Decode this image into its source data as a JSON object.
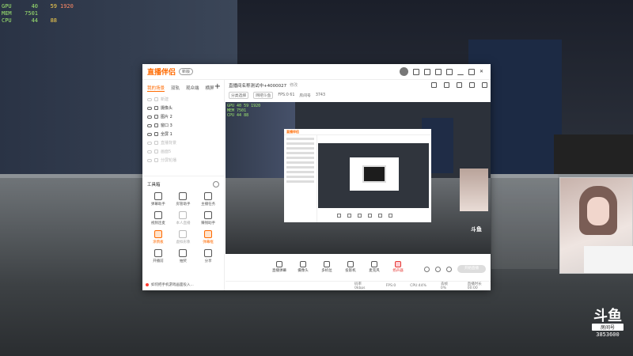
{
  "hardware": [
    {
      "label": "GPU",
      "v1": "40",
      "v2": "59",
      "v3": "1920"
    },
    {
      "label": "MEM",
      "v1": "7501",
      "v2": "",
      "v3": ""
    },
    {
      "label": "CPU",
      "v1": "44",
      "v2": "88",
      "v3": ""
    }
  ],
  "app": {
    "logo": "直播伴侣",
    "version_badge": "新版",
    "sidebar_tabs": [
      "我的场景",
      "双轨",
      "观众端",
      "横屏"
    ],
    "scenes": [
      {
        "name": "新建",
        "dim": true
      },
      {
        "name": "摄像头",
        "dim": false
      },
      {
        "name": "图片 2",
        "dim": false
      },
      {
        "name": "窗口 3",
        "dim": false
      },
      {
        "name": "全屏 1",
        "dim": false
      },
      {
        "name": "直播背景",
        "dim": true
      },
      {
        "name": "画面5",
        "dim": true
      },
      {
        "name": "分屏轮播",
        "dim": true
      }
    ],
    "tools_title": "工具箱",
    "tools": [
      {
        "label": "弹幕助手",
        "style": ""
      },
      {
        "label": "房管助手",
        "style": ""
      },
      {
        "label": "主播任务",
        "style": ""
      },
      {
        "label": "视频连麦",
        "style": ""
      },
      {
        "label": "本人直播",
        "style": "dim"
      },
      {
        "label": "赚钱助手",
        "style": ""
      },
      {
        "label": "涂鸦板",
        "style": "orange"
      },
      {
        "label": "虚拟形象",
        "style": "dim"
      },
      {
        "label": "弹幕框",
        "style": "orange"
      },
      {
        "label": "开播前",
        "style": ""
      },
      {
        "label": "抽奖",
        "style": ""
      },
      {
        "label": "分享",
        "style": ""
      }
    ],
    "footer_notice": "如何把手机游戏画面投入..."
  },
  "room": {
    "title": "直播间名称测试中+4000027",
    "edit_label": "修改",
    "sub_tags": [
      "分类选择",
      "网吧斗鱼"
    ],
    "room_info": [
      "FPS:0 61",
      "房间号",
      "3743"
    ]
  },
  "bottom_tools": [
    {
      "label": "直播弹幕",
      "red": false
    },
    {
      "label": "摄像头",
      "red": false
    },
    {
      "label": "多机位",
      "red": false
    },
    {
      "label": "投影机",
      "red": false
    },
    {
      "label": "麦克风",
      "red": false
    },
    {
      "label": "扬声器",
      "red": true
    }
  ],
  "start_button": "开始直播",
  "status_items": [
    "码率 0kbps",
    "FPS:0",
    "CPU:44%",
    "丢帧 0%",
    "直播时长 00:00"
  ],
  "douyu_badge": {
    "logo": "斗鱼",
    "tag": "房间号",
    "room_number": "3853600"
  }
}
